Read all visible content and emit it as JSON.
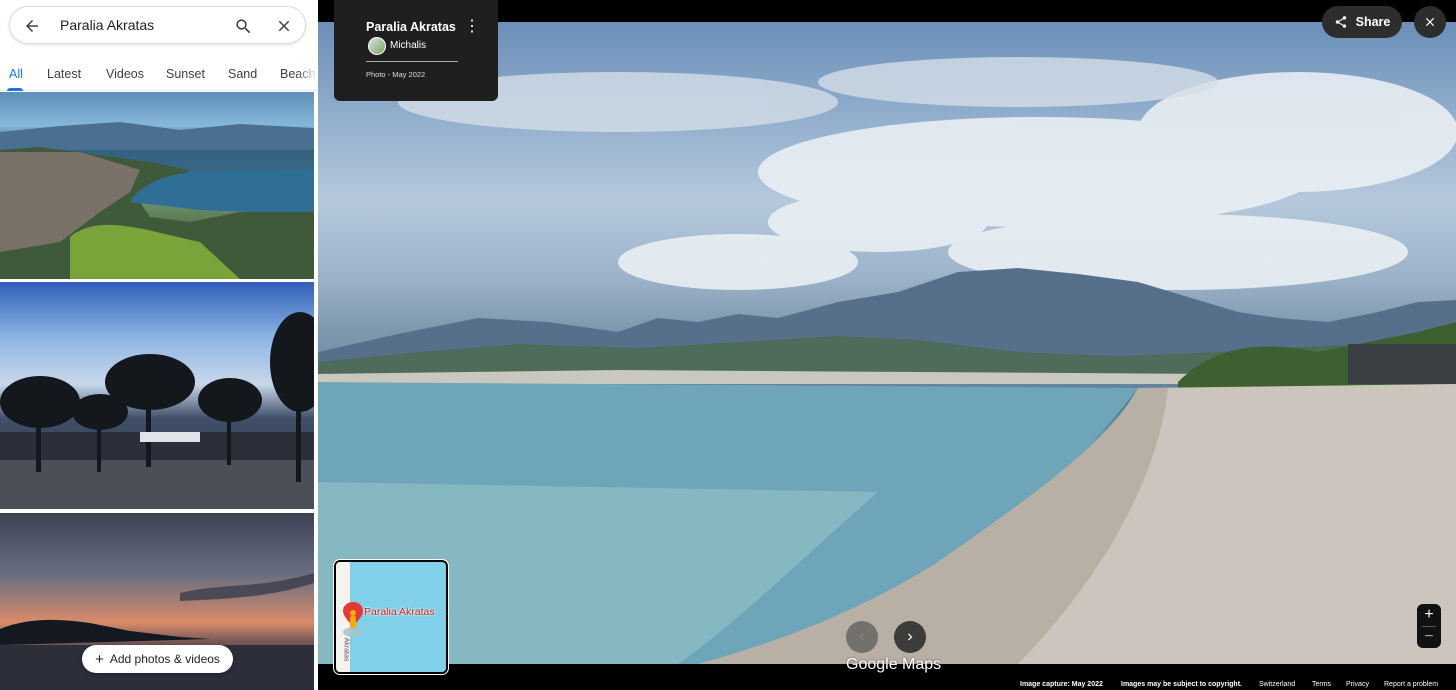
{
  "search": {
    "value": "Paralia Akratas"
  },
  "tabs": [
    {
      "label": "All",
      "active": true
    },
    {
      "label": "Latest"
    },
    {
      "label": "Videos"
    },
    {
      "label": "Sunset"
    },
    {
      "label": "Sand"
    },
    {
      "label": "Beach"
    }
  ],
  "add_media": {
    "label": "Add photos & videos"
  },
  "info": {
    "title": "Paralia Akratas",
    "author": "Michalis",
    "date": "Photo - May 2022"
  },
  "share": {
    "label": "Share"
  },
  "minimap": {
    "label": "Paralia Akratas",
    "road": "Akratas"
  },
  "zoom": {
    "in": "+",
    "out": "−"
  },
  "logo": "Google Maps",
  "footer": {
    "capture": "Image capture: May 2022",
    "copyright": "Images may be subject to copyright.",
    "region": "Switzerland",
    "terms": "Terms",
    "privacy": "Privacy",
    "report": "Report a problem"
  },
  "colors": {
    "accent": "#1a73e8",
    "panel": "#1f1f1f"
  },
  "icons": [
    "back-arrow-icon",
    "search-icon",
    "close-icon",
    "share-icon",
    "more-vert-icon",
    "chevron-left-icon",
    "chevron-right-icon",
    "plus-icon",
    "pegman-icon"
  ]
}
